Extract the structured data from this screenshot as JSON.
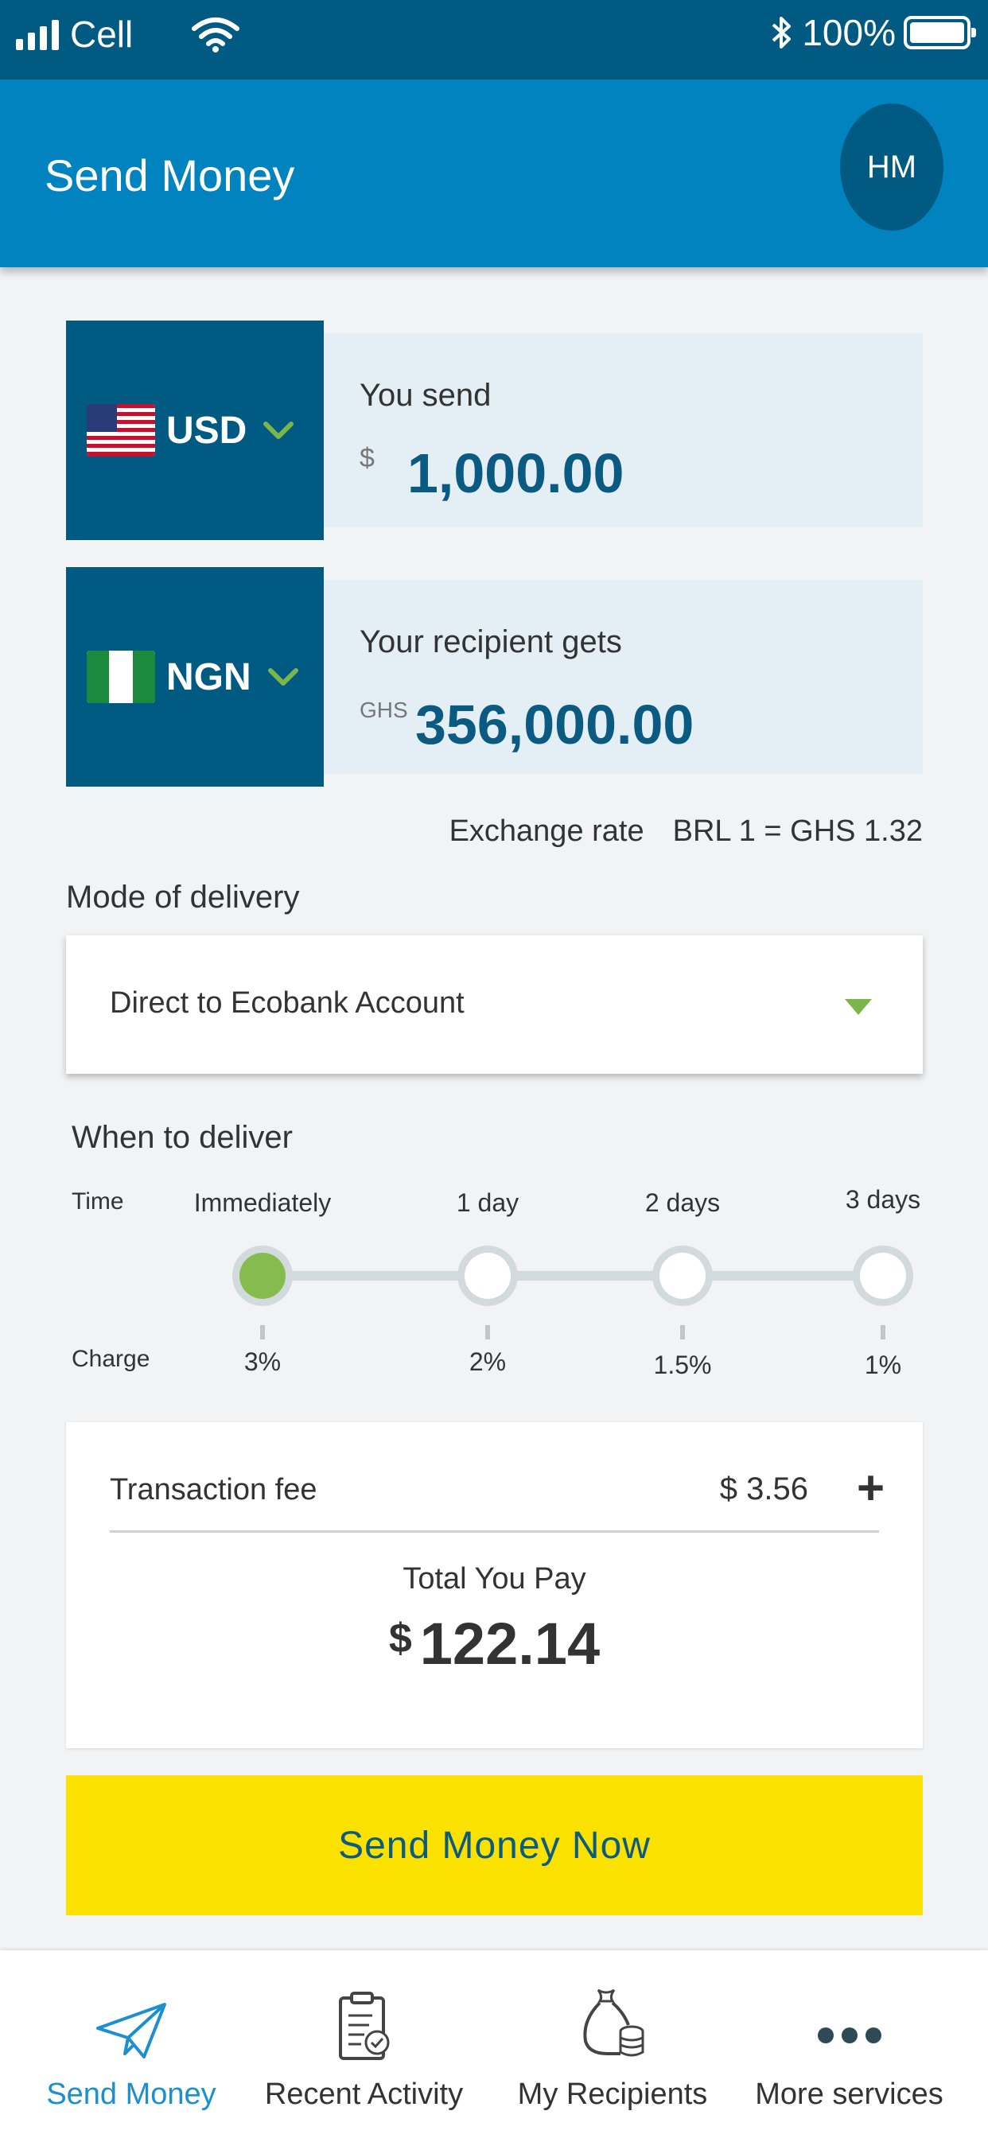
{
  "status_bar": {
    "carrier": "Cell",
    "battery": "100%"
  },
  "header": {
    "title": "Send Money",
    "avatar_initials": "HM"
  },
  "send": {
    "currency": "USD",
    "label": "You send",
    "symbol": "$",
    "amount": "1,000.00"
  },
  "receive": {
    "currency": "NGN",
    "label": "Your recipient gets",
    "symbol": "GHS",
    "amount": "356,000.00"
  },
  "exchange": {
    "label": "Exchange rate",
    "value": "BRL 1 = GHS 1.32"
  },
  "delivery": {
    "label": "Mode of delivery",
    "selected": "Direct to Ecobank Account"
  },
  "when": {
    "label": "When to deliver",
    "time_label": "Time",
    "charge_label": "Charge",
    "selected_index": 0,
    "options": [
      {
        "time": "Immediately",
        "charge": "3%"
      },
      {
        "time": "1 day",
        "charge": "2%"
      },
      {
        "time": "2 days",
        "charge": "1.5%"
      },
      {
        "time": "3 days",
        "charge": "1%"
      }
    ]
  },
  "fee": {
    "label": "Transaction fee",
    "value": "$ 3.56",
    "expand_symbol": "+"
  },
  "total": {
    "label": "Total You Pay",
    "symbol": "$",
    "amount": "122.14"
  },
  "cta": {
    "label": "Send Money Now"
  },
  "nav": [
    {
      "label": "Send Money",
      "icon": "paper-plane-icon",
      "active": true
    },
    {
      "label": "Recent Activity",
      "icon": "clipboard-check-icon",
      "active": false
    },
    {
      "label": "My Recipients",
      "icon": "money-bag-icon",
      "active": false
    },
    {
      "label": "More services",
      "icon": "more-dots-icon",
      "active": false
    }
  ],
  "colors": {
    "primary": "#0083be",
    "dark": "#005a82",
    "accent_green": "#86bc4d",
    "cta_yellow": "#fae100",
    "nav_active": "#1a8fd1"
  }
}
